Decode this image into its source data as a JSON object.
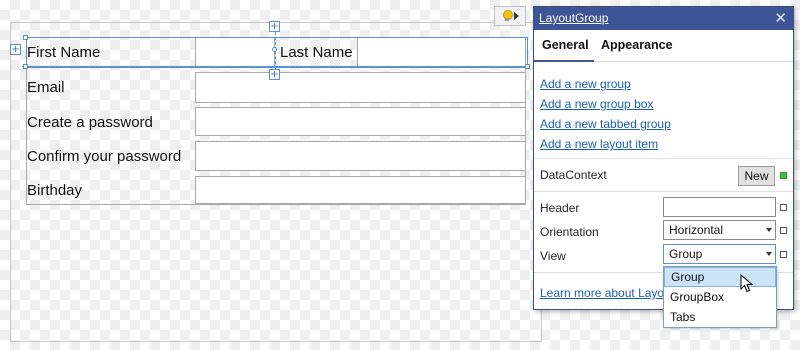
{
  "form": {
    "rows": [
      {
        "label": "First Name",
        "second_label": "Last Name"
      },
      {
        "label": "Email"
      },
      {
        "label": "Create a password"
      },
      {
        "label": "Confirm your password"
      },
      {
        "label": "Birthday"
      }
    ]
  },
  "panel": {
    "title": "LayoutGroup",
    "close_glyph": "✕",
    "tabs": [
      "General",
      "Appearance"
    ],
    "links": [
      "Add a new group",
      "Add a new group box",
      "Add a new tabbed group",
      "Add a new layout item"
    ],
    "datacontext_label": "DataContext",
    "new_button": "New",
    "header_label": "Header",
    "header_value": "",
    "orientation_label": "Orientation",
    "orientation_value": "Horizontal",
    "view_label": "View",
    "view_value": "Group",
    "view_options": [
      "Group",
      "GroupBox",
      "Tabs"
    ],
    "learn_more": "Learn more about Layo"
  },
  "colors": {
    "title_bar": "#3d5597",
    "selection": "#5b8fd6",
    "link": "#1a5fb4",
    "highlight": "#cce4f7",
    "status_green": "#3cc33c"
  },
  "icons": {
    "smart_tag": "lightbulb-icon",
    "expand": "chevron-right-icon",
    "close": "close-icon",
    "dropdown": "chevron-down-icon",
    "cursor": "mouse-pointer-icon"
  }
}
